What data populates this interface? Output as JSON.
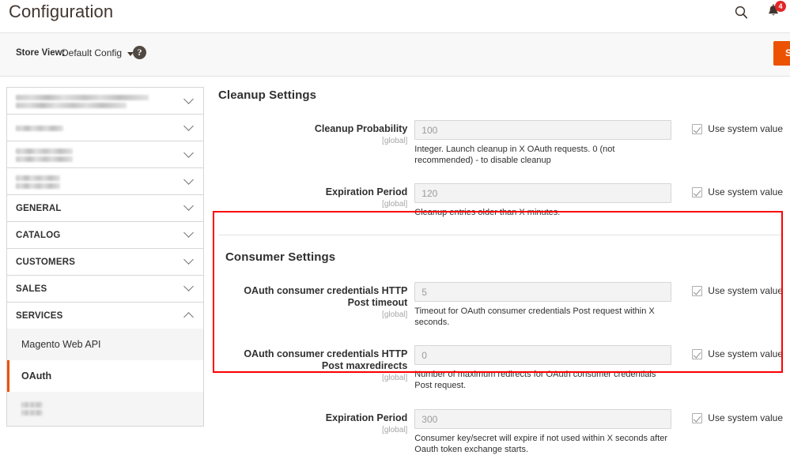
{
  "header": {
    "title": "Configuration",
    "search_icon": "search-icon",
    "notifications_icon": "bell-icon",
    "notifications_count": "4"
  },
  "storeview": {
    "label": "Store View:",
    "selected": "Default Config",
    "help_icon": "question-mark-icon",
    "save_label": "Save Config"
  },
  "sidebar": {
    "sections": [
      {
        "label": "",
        "blurred": true,
        "bars": [
          168,
          140
        ],
        "expanded": false
      },
      {
        "label": "",
        "blurred": true,
        "bars": [
          60
        ],
        "expanded": false
      },
      {
        "label": "",
        "blurred": true,
        "bars": [
          72,
          72
        ],
        "expanded": false
      },
      {
        "label": "",
        "blurred": true,
        "bars": [
          56,
          56
        ],
        "expanded": false
      },
      {
        "label": "GENERAL",
        "blurred": false,
        "expanded": false
      },
      {
        "label": "CATALOG",
        "blurred": false,
        "expanded": false
      },
      {
        "label": "CUSTOMERS",
        "blurred": false,
        "expanded": false
      },
      {
        "label": "SALES",
        "blurred": false,
        "expanded": false
      },
      {
        "label": "SERVICES",
        "blurred": false,
        "expanded": true
      }
    ],
    "services_items": [
      {
        "label": "Magento Web API",
        "active": false,
        "blurred": false
      },
      {
        "label": "OAuth",
        "active": true,
        "blurred": false
      },
      {
        "label": "",
        "active": false,
        "blurred": true,
        "bars": [
          27,
          27
        ]
      }
    ]
  },
  "main": {
    "cleanup_section": {
      "title": "Cleanup Settings",
      "fields": [
        {
          "label": "Cleanup Probability",
          "scope": "[global]",
          "value": "100",
          "note": "Integer. Launch cleanup in X OAuth requests. 0 (not recommended) - to disable cleanup",
          "use_system_value": "Use system value",
          "checked": true
        },
        {
          "label": "Expiration Period",
          "scope": "[global]",
          "value": "120",
          "note": "Cleanup entries older than X minutes.",
          "use_system_value": "Use system value",
          "checked": true
        }
      ]
    },
    "consumer_section": {
      "title": "Consumer Settings",
      "highlighted": true,
      "highlight_color": "#ff0000",
      "fields": [
        {
          "label": "OAuth consumer credentials HTTP Post timeout",
          "scope": "[global]",
          "value": "5",
          "note": "Timeout for OAuth consumer credentials Post request within X seconds.",
          "use_system_value": "Use system value",
          "checked": true
        },
        {
          "label": "OAuth consumer credentials HTTP Post maxredirects",
          "scope": "[global]",
          "value": "0",
          "note": "Number of maximum redirects for OAuth consumer credentials Post request.",
          "use_system_value": "Use system value",
          "checked": true
        },
        {
          "label": "Expiration Period",
          "scope": "[global]",
          "value": "300",
          "note": "Consumer key/secret will expire if not used within X seconds after Oauth token exchange starts.",
          "use_system_value": "Use system value",
          "checked": true
        }
      ]
    }
  },
  "colors": {
    "accent_orange": "#eb5202",
    "highlight_red": "#ff0000",
    "badge_red": "#e22626"
  }
}
